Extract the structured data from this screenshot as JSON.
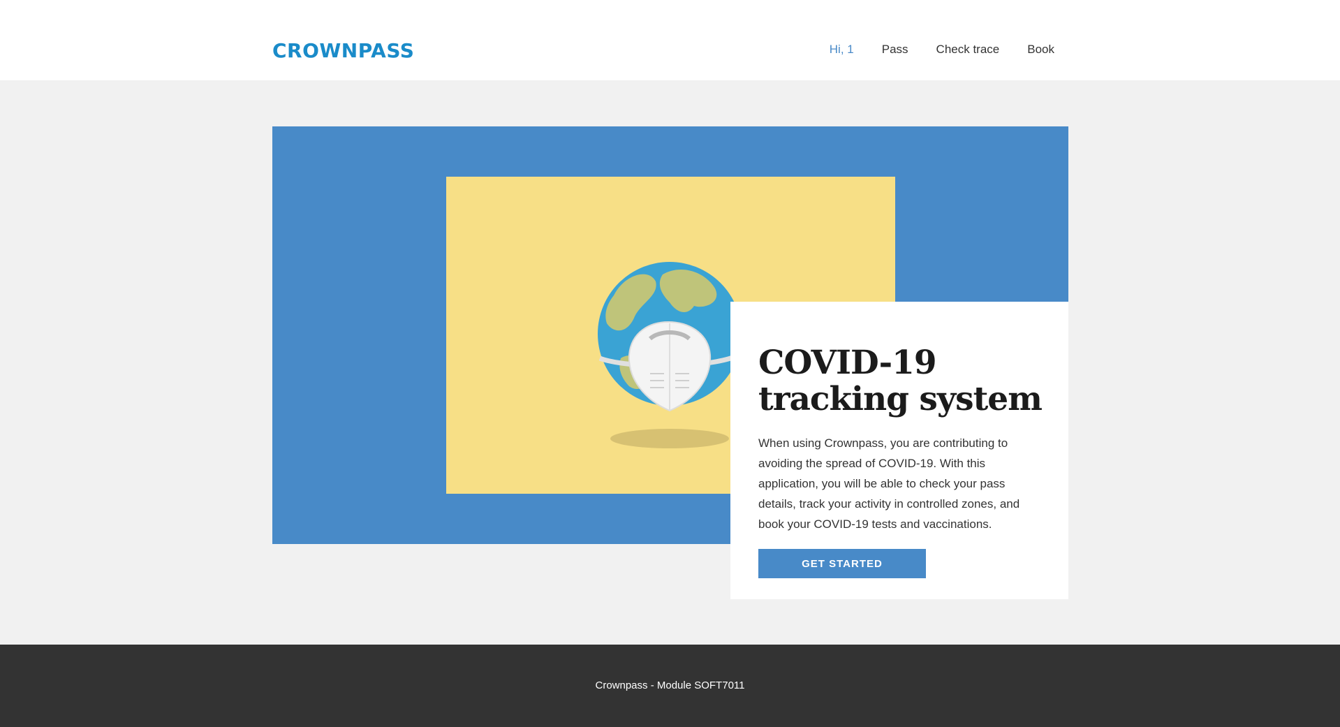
{
  "header": {
    "logo": "CROWNPASS",
    "nav": [
      {
        "label": "Hi, 1"
      },
      {
        "label": "Pass"
      },
      {
        "label": "Check trace"
      },
      {
        "label": "Book"
      }
    ]
  },
  "hero": {
    "title": "COVID-19 tracking system",
    "description": "When using Crownpass, you are contributing to avoiding the spread of COVID-19. With this application, you will be able to check your pass details, track your activity in controlled zones, and book your COVID-19 tests and vaccinations.",
    "cta": "GET STARTED"
  },
  "footer": {
    "text": "Crownpass - Module SOFT7011"
  },
  "colors": {
    "brand": "#1a8bc9",
    "accent": "#488ac8",
    "illustration_bg": "#f7df86",
    "footer_bg": "#333333"
  }
}
